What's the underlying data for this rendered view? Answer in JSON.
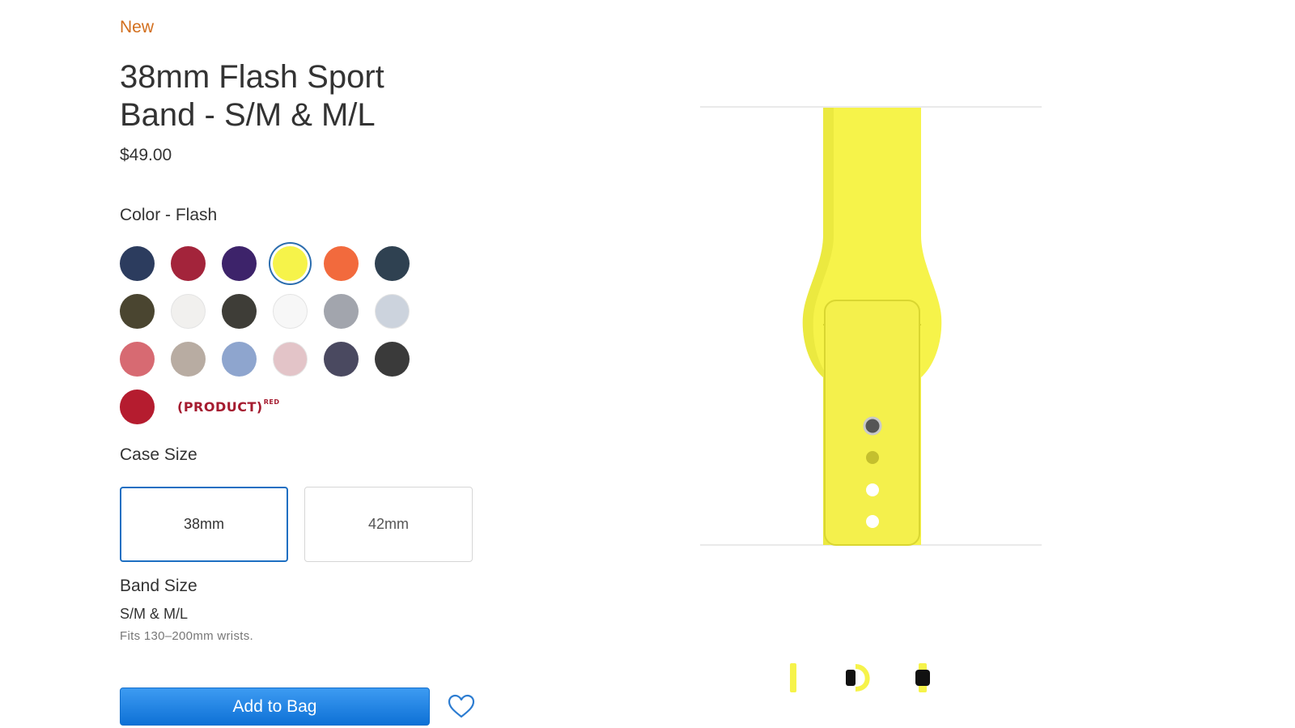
{
  "product": {
    "badge": "New",
    "title": "38mm Flash Sport Band - S/M & M/L",
    "price": "$49.00"
  },
  "color": {
    "label": "Color - Flash",
    "swatches": [
      [
        "#2c3c5e",
        "#a3243b",
        "#3d236a",
        "#f6f34a",
        "#f26a3d",
        "#2f4151"
      ],
      [
        "#4a4530",
        "#f1f0ee",
        "#3e3d37",
        "#f7f7f7",
        "#a2a5ad",
        "#ccd3dd"
      ],
      [
        "#d76a72",
        "#b8aca2",
        "#8ea5ce",
        "#e3c4c8",
        "#4a4960",
        "#3a3a3a"
      ],
      [
        "#b51c2f"
      ]
    ],
    "selected": "#f6f34a",
    "product_red": {
      "text": "(PRODUCT)",
      "superscript": "RED"
    }
  },
  "case_size": {
    "label": "Case Size",
    "options": [
      "38mm",
      "42mm"
    ],
    "selected": "38mm"
  },
  "band_size": {
    "label": "Band Size",
    "value": "S/M & M/L",
    "fit": "Fits 130–200mm wrists."
  },
  "actions": {
    "add_to_bag": "Add to Bag"
  },
  "colors": {
    "accent": "#0e71d6",
    "new_badge": "#d26f1e",
    "band": "#f6f34a"
  }
}
